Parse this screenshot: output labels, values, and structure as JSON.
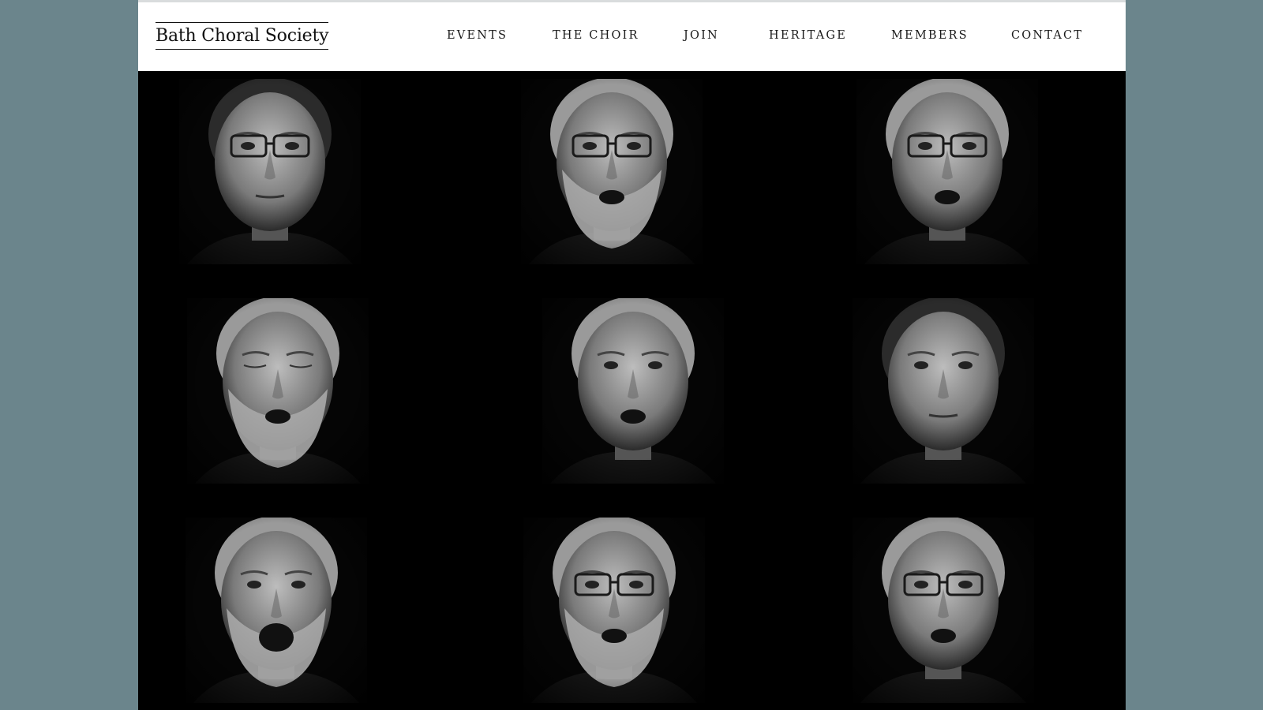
{
  "site": {
    "logo_text": "Bath Choral Society"
  },
  "nav": {
    "items": [
      {
        "label": "EVENTS"
      },
      {
        "label": "THE CHOIR"
      },
      {
        "label": "JOIN"
      },
      {
        "label": "HERITAGE"
      },
      {
        "label": "MEMBERS"
      },
      {
        "label": "CONTACT"
      }
    ]
  },
  "gallery": {
    "portraits": [
      {
        "glasses": true,
        "beard": false,
        "mouth": "closed",
        "hair": "dark"
      },
      {
        "glasses": true,
        "beard": true,
        "mouth": "open",
        "hair": "grey"
      },
      {
        "glasses": true,
        "beard": false,
        "mouth": "open",
        "hair": "grey"
      },
      {
        "glasses": false,
        "beard": true,
        "mouth": "open",
        "hair": "grey",
        "eyes": "closed"
      },
      {
        "glasses": false,
        "beard": false,
        "mouth": "open",
        "hair": "grey"
      },
      {
        "glasses": false,
        "beard": false,
        "mouth": "closed",
        "hair": "dark"
      },
      {
        "glasses": false,
        "beard": true,
        "mouth": "wide",
        "hair": "grey"
      },
      {
        "glasses": true,
        "beard": true,
        "mouth": "open",
        "hair": "grey"
      },
      {
        "glasses": true,
        "beard": false,
        "mouth": "open",
        "hair": "grey"
      }
    ]
  },
  "colors": {
    "side_background": "#6b858c",
    "header_background": "#ffffff",
    "gallery_background": "#000000",
    "text": "#1a1a1a"
  }
}
